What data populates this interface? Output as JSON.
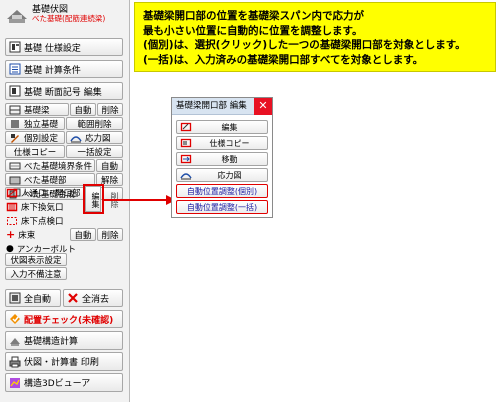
{
  "panel": {
    "title": "基礎伏図",
    "subtitle": "べた基礎(配筋連続梁)",
    "top_buttons": [
      {
        "label": "基礎 仕様設定"
      },
      {
        "label": "基礎 計算条件"
      },
      {
        "label": "基礎 断面記号 編集"
      }
    ],
    "rows": {
      "kisobari": "基礎梁",
      "kisobari_auto": "自動",
      "kisobari_delete": "削除",
      "dokuritsu": "独立基礎",
      "range_delete": "範囲削除",
      "kobetsu": "個別設定",
      "stress_diagram": "応力図",
      "spec_copy": "仕様コピー",
      "bulk_setting": "一括設定",
      "beta_boundary": "べた基礎境界条件",
      "beta_boundary_auto": "自動",
      "beta_part": "べた基礎部",
      "beta_part_cancel": "解除",
      "beta_combine": "べた基礎合成"
    },
    "openings": {
      "entrance": "人通口・開口部",
      "underfloor_vent": "床下換気口",
      "underfloor_inspection": "床下点検口",
      "edit": "編集",
      "delete": "削除"
    },
    "floor_beam": {
      "label": "床束",
      "auto": "自動",
      "delete": "削除"
    },
    "anchor_bolt": "アンカーボルト",
    "display_settings": "伏図表示設定",
    "input_check": "入力不備注意",
    "all_auto": "全自動",
    "all_erase": "全消去",
    "layout_check": "配置チェック(未確認)",
    "structural_calc": "基礎構造計算",
    "print": "伏図・計算書 印刷",
    "viewer3d": "構造3Dビューア"
  },
  "callout": {
    "lines": [
      "基礎梁開口部の位置を基礎梁スパン内で応力が",
      "最も小さい位置に自動的に位置を調整します。",
      "(個別)は、選択(クリック)した一つの基礎梁開口部を対象とします。",
      "(一括)は、入力済みの基礎梁開口部すべてを対象とします。"
    ]
  },
  "dialog": {
    "title": "基礎梁開口部 編集",
    "close": "✕",
    "buttons": [
      {
        "label": "編集"
      },
      {
        "label": "仕様コピー"
      },
      {
        "label": "移動"
      },
      {
        "label": "応力図"
      },
      {
        "label": "自動位置調整(個別)"
      },
      {
        "label": "自動位置調整(一括)"
      }
    ]
  },
  "colors": {
    "accent_red": "#e00000",
    "callout_yellow": "#ffff00",
    "title_blue": "#d8e4f1"
  }
}
